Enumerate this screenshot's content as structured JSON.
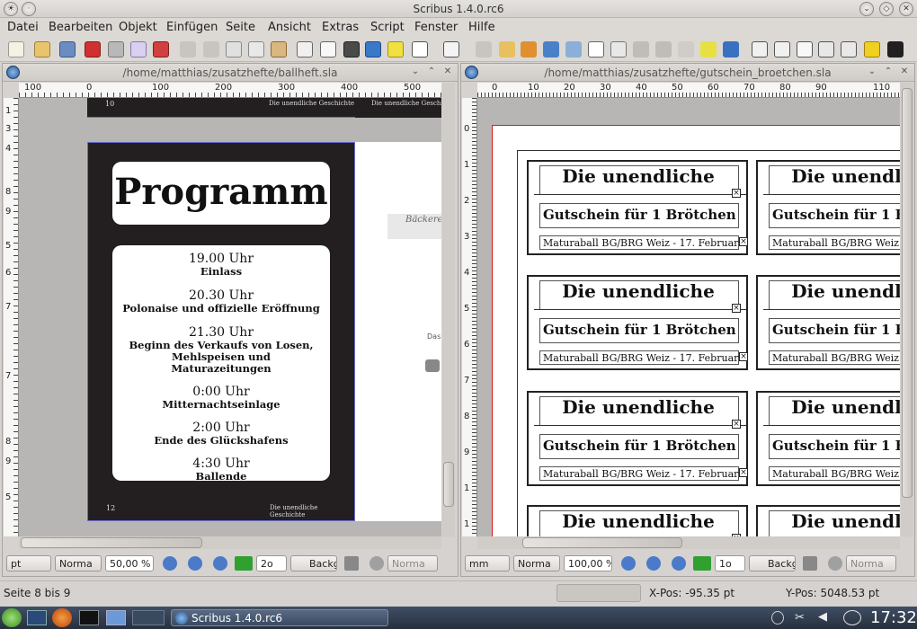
{
  "window": {
    "title": "Scribus 1.4.0.rc6"
  },
  "menu": [
    "Datei",
    "Bearbeiten",
    "Objekt",
    "Einfügen",
    "Seite",
    "Ansicht",
    "Extras",
    "Script",
    "Fenster",
    "Hilfe"
  ],
  "doc_left": {
    "path": "/home/matthias/zusatzhefte/ballheft.sla",
    "ruler": [
      "100",
      "0",
      "100",
      "200",
      "300",
      "400",
      "500"
    ],
    "vruler": [
      "1",
      "3",
      "4",
      "8",
      "9",
      "5",
      "6",
      "7",
      "7",
      "8",
      "9",
      "5"
    ],
    "page_num_top": "10",
    "page_footer_top": "Die unendliche Geschichte",
    "page_footer_top2": "Die unendliche Geschichte",
    "program": {
      "title": "Programm",
      "items": [
        {
          "time": "19.00 Uhr",
          "desc": "Einlass"
        },
        {
          "time": "20.30 Uhr",
          "desc": "Polonaise und offizielle Eröffnung"
        },
        {
          "time": "21.30 Uhr",
          "desc": "Beginn des Verkaufs von Losen, Mehlspeisen und Maturazeitungen"
        },
        {
          "time": "0:00 Uhr",
          "desc": "Mitternachtseinlage"
        },
        {
          "time": "2:00 Uhr",
          "desc": "Ende des Glückshafens"
        },
        {
          "time": "4:30 Uhr",
          "desc": "Ballende"
        }
      ]
    },
    "page_num_bottom": "12",
    "page_footer_bottom": "Die unendliche Geschichte",
    "side_text": {
      "bakery": "Bäckerei",
      "das": "Das"
    },
    "units": "pt",
    "mode": "Norma",
    "zoom": "50,00 %",
    "page_select": "2o",
    "layer": "Backgr",
    "preview": "Norma"
  },
  "doc_right": {
    "path": "/home/matthias/zusatzhefte/gutschein_broetchen.sla",
    "ruler": [
      "0",
      "10",
      "20",
      "30",
      "40",
      "50",
      "60",
      "70",
      "80",
      "90",
      "110"
    ],
    "vruler": [
      "0",
      "1",
      "2",
      "3",
      "4",
      "5",
      "6",
      "7",
      "8",
      "9",
      "1",
      "1"
    ],
    "voucher": {
      "title": "Die unendliche",
      "subtitle": "Gutschein für 1 Brötchen",
      "footer": "Maturaball BG/BRG Weiz - 17. Februar"
    },
    "units": "mm",
    "mode": "Norma",
    "zoom": "100,00 %",
    "page_select": "1o",
    "layer": "Backgr",
    "preview": "Norma"
  },
  "status": {
    "pages": "Seite 8 bis 9",
    "xpos": "X-Pos: -95.35 pt",
    "ypos": "Y-Pos: 5048.53 pt"
  },
  "taskbar": {
    "task": "Scribus 1.4.0.rc6",
    "clock": "17:32"
  },
  "colors": {
    "accent": "#3a6ea5",
    "page_dark": "#231f20",
    "guide_red": "#d02020"
  }
}
